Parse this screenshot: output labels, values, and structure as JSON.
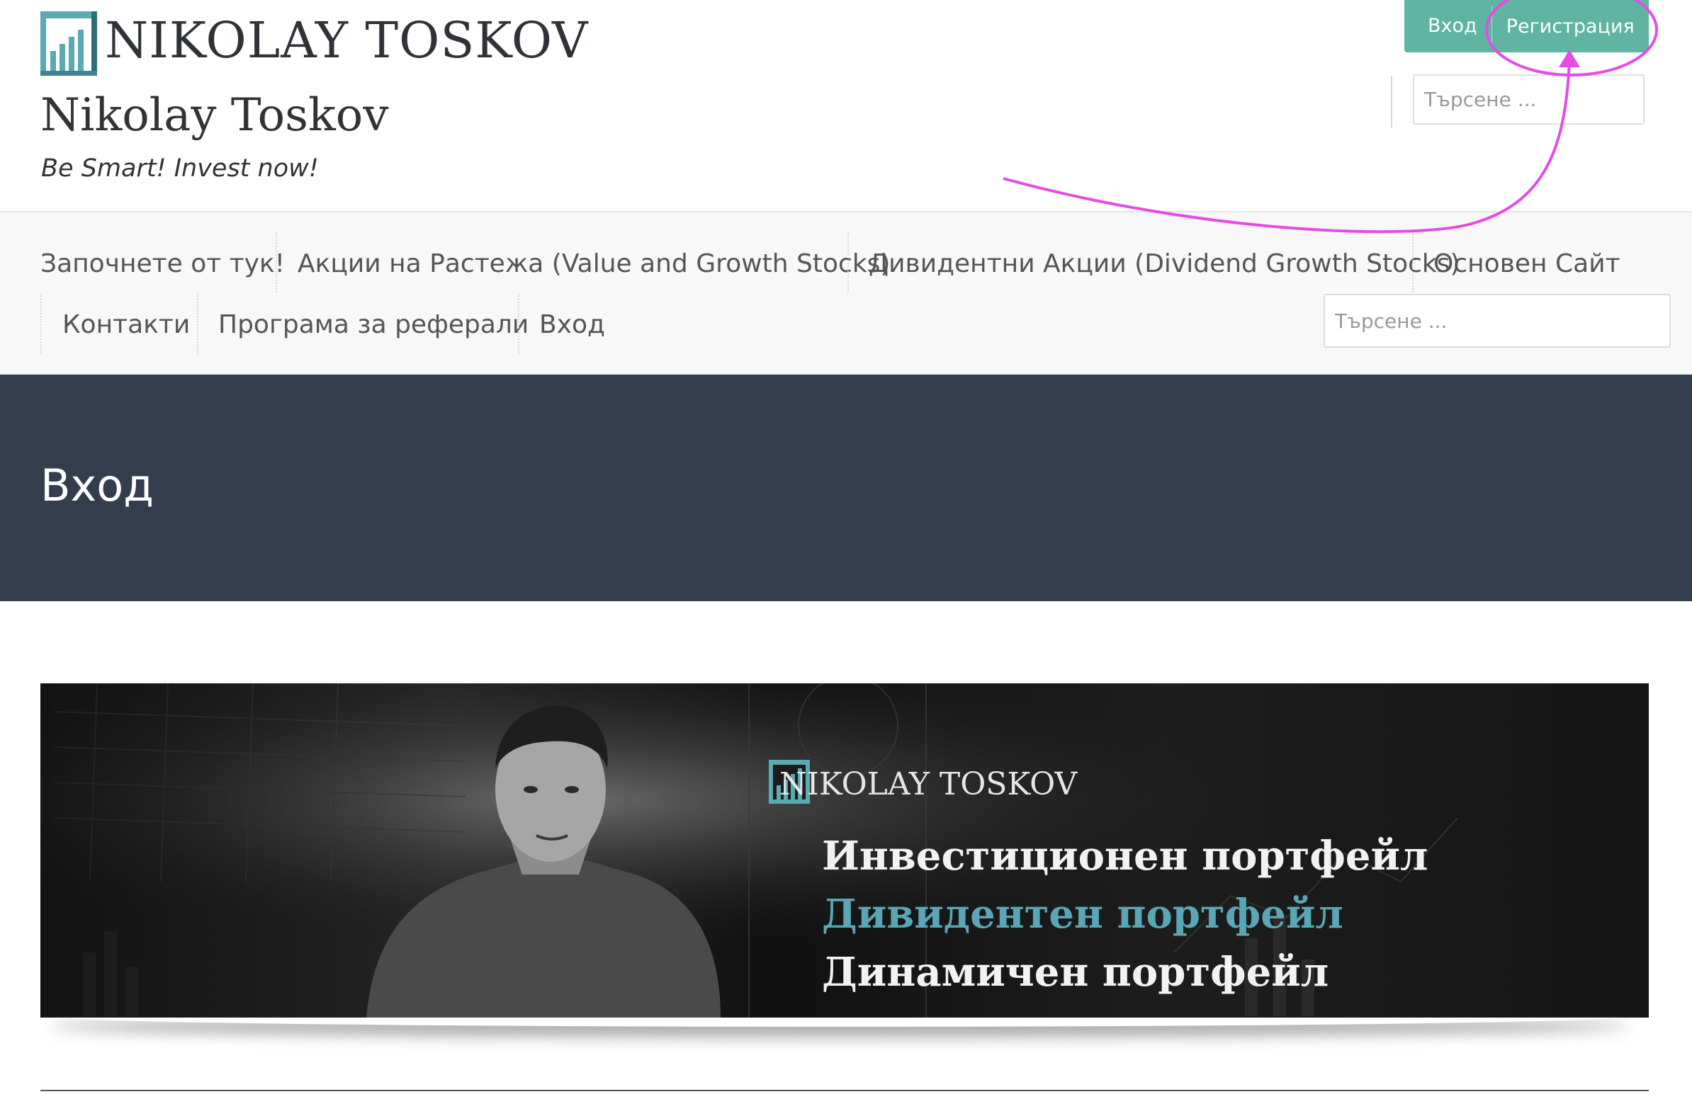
{
  "header": {
    "logo_text": "NIKOLAY TOSKOV",
    "site_title": "Nikolay Toskov",
    "tagline": "Be Smart! Invest now!",
    "top_login": "Вход",
    "top_register": "Регистрация",
    "search_placeholder": "Търсене ..."
  },
  "nav": {
    "items": [
      "Започнете от тук!",
      "Акции на Растежа (Value and Growth Stocks)",
      "Дивидентни Акции (Dividend Growth Stocks)",
      "Основен Сайт",
      "Контакти",
      "Програма за реферали",
      "Вход"
    ],
    "search_placeholder": "Търсене ..."
  },
  "page": {
    "title": "Вход"
  },
  "banner": {
    "logo_text": "NIKOLAY TOSKOV",
    "lines": [
      "Инвестиционен портфейл",
      "Дивидентен портфейл",
      "Динамичен портфейл"
    ]
  },
  "colors": {
    "accent_green": "#5fb4a2",
    "title_band": "#333d4d",
    "logo_teal": "#5aa9b3",
    "highlight_teal": "#5ba6b5",
    "annotation_magenta": "#e44ce4"
  }
}
